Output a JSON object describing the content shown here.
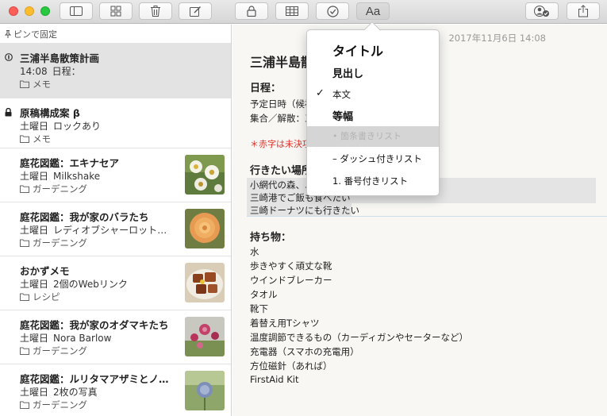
{
  "toolbar": {
    "buttons": [
      {
        "name": "sidebar-toggle-button",
        "icon": "sidebar-icon"
      },
      {
        "name": "attachments-browser-button",
        "icon": "grid-icon"
      },
      {
        "name": "delete-button",
        "icon": "trash-icon"
      },
      {
        "name": "new-note-button",
        "icon": "compose-icon"
      },
      {
        "name": "lock-button",
        "icon": "lock-icon"
      },
      {
        "name": "table-button",
        "icon": "table-icon"
      },
      {
        "name": "checklist-button",
        "icon": "checkmark-circle-icon"
      },
      {
        "name": "format-button",
        "icon": "text-format-icon"
      },
      {
        "name": "add-people-button",
        "icon": "add-person-icon"
      },
      {
        "name": "share-button",
        "icon": "share-icon"
      }
    ],
    "format_label": "Aa"
  },
  "sidebar": {
    "pin_header": "ピンで固定",
    "notes": [
      {
        "title": "三浦半島散策計画",
        "time": "14:08",
        "snippet": "日程：",
        "folder": "メモ",
        "pinned": true,
        "selected": true
      },
      {
        "title": "原稿構成案 β",
        "time": "土曜日",
        "snippet": "ロックあり",
        "folder": "メモ",
        "locked": true
      },
      {
        "title": "庭花図鑑：エキナセア",
        "time": "土曜日",
        "snippet": "Milkshake",
        "folder": "ガーデニング",
        "thumbnail": "white-flowers"
      },
      {
        "title": "庭花図鑑：我が家のバラたち",
        "time": "土曜日",
        "snippet": "レディオブシャーロット（D…",
        "folder": "ガーデニング",
        "thumbnail": "orange-rose"
      },
      {
        "title": "おかずメモ",
        "time": "土曜日",
        "snippet": "2個のWebリンク",
        "folder": "レシピ",
        "thumbnail": "braised-pork"
      },
      {
        "title": "庭花図鑑：我が家のオダマキたち",
        "time": "土曜日",
        "snippet": "Nora Barlow",
        "folder": "ガーデニング",
        "thumbnail": "pink-flowers"
      },
      {
        "title": "庭花図鑑：ルリタマアザミとノア…",
        "time": "土曜日",
        "snippet": "2枚の写真",
        "folder": "ガーデニング",
        "thumbnail": "globe-thistle"
      }
    ]
  },
  "editor": {
    "date": "2017年11月6日 14:08",
    "title": "三浦半島散",
    "schedule_heading": "日程：",
    "schedule_lines": [
      "予定日時（候補",
      "集合／解散：三"
    ],
    "red_note": "＊赤字は未決項",
    "places_heading": "行きたい場所",
    "places_lines": [
      "小網代の森、ユ",
      "三崎港でご飯も食べたい",
      "三崎ドーナツにも行きたい"
    ],
    "items_heading": "持ち物：",
    "items": [
      "水",
      "歩きやすく頑丈な靴",
      "ウインドブレーカー",
      "タオル",
      "靴下",
      "着替え用Tシャツ",
      "温度調節できるもの（カーディガンやセーターなど）",
      "充電器（スマホの充電用）",
      "方位磁針（あれば）",
      "FirstAid Kit"
    ]
  },
  "format_menu": {
    "items": [
      {
        "name": "format-title",
        "label": "タイトル"
      },
      {
        "name": "format-heading",
        "label": "見出し"
      },
      {
        "name": "format-body",
        "label": "本文",
        "checked": true
      },
      {
        "name": "format-monospaced",
        "label": "等幅"
      },
      {
        "name": "format-bulleted-list",
        "label": "• 箇条書きリスト",
        "disabled": true
      },
      {
        "name": "format-dashed-list",
        "label": "– ダッシュ付きリスト"
      },
      {
        "name": "format-numbered-list",
        "label": "1. 番号付きリスト"
      }
    ],
    "check_mark": "✓"
  },
  "colors": {
    "selected_note_bg": "#e3e3e3",
    "editor_bg": "#f8f7f3",
    "red_text": "#e0322b"
  }
}
